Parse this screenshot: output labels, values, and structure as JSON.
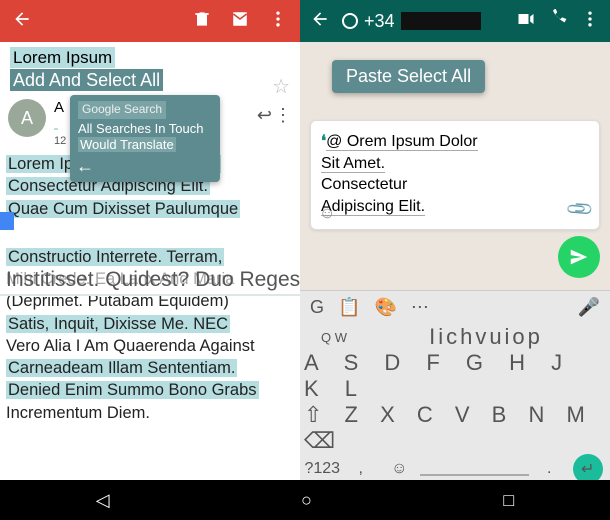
{
  "gmail": {
    "subject_line1": "Lorem Ipsum",
    "selection_bar": "Add And Select All",
    "star": "☆",
    "tooltip": {
      "title": "Google Search",
      "line1": "All Searches In Touch",
      "line2": "Would Translate",
      "back": "←"
    },
    "avatar_letter": "A",
    "sender_sub": "12",
    "reply": "↩",
    "more": "⋮",
    "body": {
      "p1a": "Lorem Ipsum Dolor Sit Amet.",
      "p1b": "Consectetur Adipiscing Elit.",
      "p1c": "Quae Cum Dixisset Paulumque",
      "tab_overlay": "Institisset. Quidest? Duo Reges: Gif",
      "p2a": "Constructio Interrete. Terram,",
      "p2b": "Mihi Crede. Ea Lanx And Maria",
      "p2c": "(Deprimet. Putabam Equidem)",
      "p2d": "Satis, Inquit, Dixisse Me. NEC",
      "p3a": "Vero Alia I Am Quaerenda Against",
      "p3b": "Carneadeam Illam Sententiam.",
      "p3c": "Denied Enim Summo Bono Grabs",
      "p3d": "Incrementum Diem."
    }
  },
  "whatsapp": {
    "header_prefix": "+34",
    "menu": "Paste Select All",
    "input": {
      "cursor": "❛",
      "l1": "@ Orem Ipsum Dolor",
      "l2": "Sit Amet.",
      "l3": "Consectetur",
      "l4": "Adipiscing Elit.",
      "emoji": "☺",
      "attach": "📎"
    }
  },
  "keyboard": {
    "toolbar": {
      "logo": "G",
      "clip": "📋",
      "palette": "🎨",
      "dots": "⋯",
      "mic": "🎤"
    },
    "row1_small": "Q W",
    "row1_big": "Iichvuiop",
    "row2": "A S D F G H J K L",
    "row3": "⇧  Z X C V B N M  ⌫",
    "row4_left": "?123",
    "row4_comma": ",",
    "row4_emoji": "☺",
    "row4_dot": ".",
    "row4_enter": "↵"
  },
  "nav": {
    "back": "◁",
    "home": "○",
    "recent": "□"
  }
}
